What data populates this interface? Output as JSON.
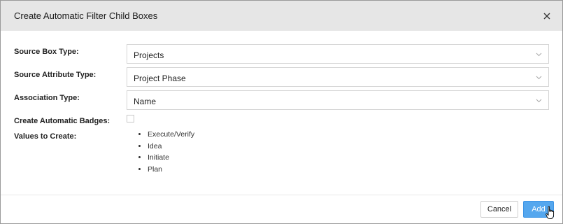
{
  "dialog": {
    "title": "Create Automatic Filter Child Boxes",
    "close_icon": "close-icon"
  },
  "form": {
    "source_box_type": {
      "label": "Source Box Type:",
      "value": "Projects"
    },
    "source_attribute_type": {
      "label": "Source Attribute Type:",
      "value": "Project Phase"
    },
    "association_type": {
      "label": "Association Type:",
      "value": "Name"
    },
    "create_automatic_badges": {
      "label": "Create Automatic Badges:",
      "checked": false
    },
    "values_to_create": {
      "label": "Values to Create:",
      "items": [
        "Execute/Verify",
        "Idea",
        "Initiate",
        "Plan"
      ]
    }
  },
  "footer": {
    "cancel_label": "Cancel",
    "add_label": "Add"
  },
  "colors": {
    "header_bg": "#e6e6e6",
    "primary_button": "#55a7ee"
  }
}
